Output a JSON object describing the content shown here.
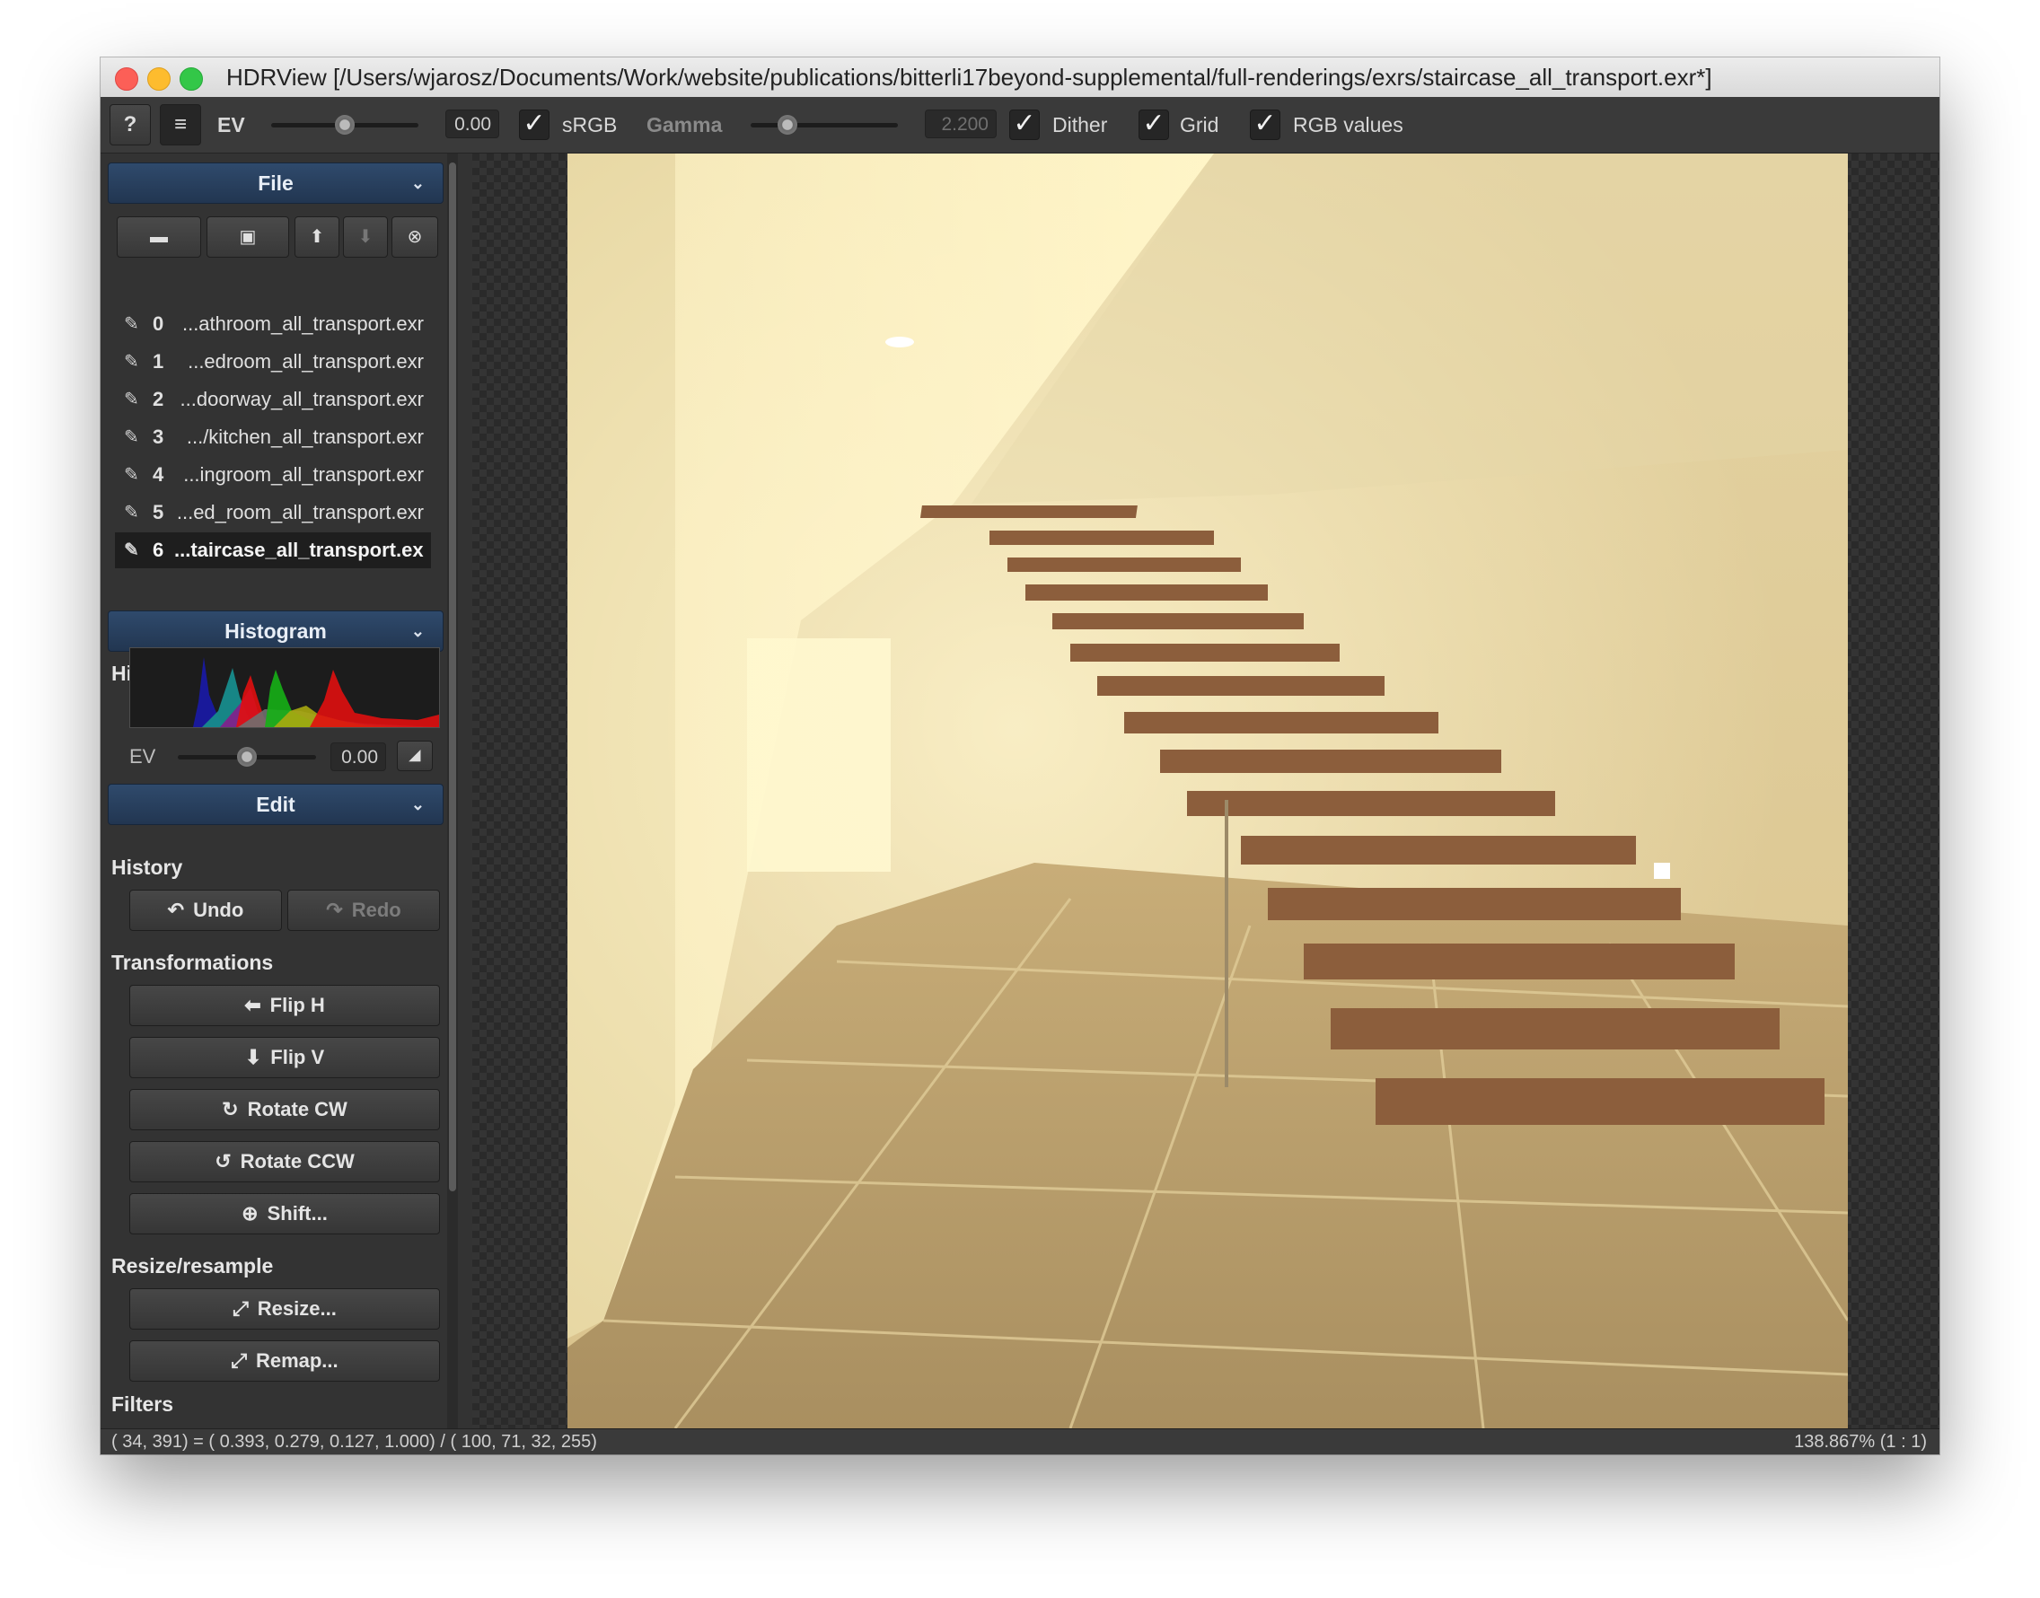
{
  "window": {
    "title": "HDRView [/Users/wjarosz/Documents/Work/website/publications/bitterli17beyond-supplemental/full-renderings/exrs/staircase_all_transport.exr*]"
  },
  "toolbar": {
    "help_label": "?",
    "menu_label": "≡",
    "ev_label": "EV",
    "ev_value": "0.00",
    "ev_slider_fraction": 0.5,
    "srgb_label": "sRGB",
    "srgb_checked": true,
    "gamma_label": "Gamma",
    "gamma_value": "2.200",
    "gamma_slider_fraction": 0.25,
    "dither_label": "Dither",
    "dither_checked": true,
    "grid_label": "Grid",
    "grid_checked": true,
    "rgb_values_label": "RGB values",
    "rgb_values_checked": true,
    "check_glyph": "✓"
  },
  "sidebar": {
    "file_section": {
      "title": "File",
      "chevron": "⌄"
    },
    "file_buttons": [
      {
        "icon": "folder-open-icon",
        "glyph": "▬",
        "enabled": true
      },
      {
        "icon": "save-icon",
        "glyph": "▣",
        "enabled": true
      },
      {
        "icon": "arrow-up-icon",
        "glyph": "⬆",
        "enabled": true
      },
      {
        "icon": "arrow-down-icon",
        "glyph": "⬇",
        "enabled": false
      },
      {
        "icon": "close-circle-icon",
        "glyph": "⊗",
        "enabled": true
      }
    ],
    "files": [
      {
        "index": "0",
        "name": "...athroom_all_transport.exr",
        "selected": false
      },
      {
        "index": "1",
        "name": "...edroom_all_transport.exr",
        "selected": false
      },
      {
        "index": "2",
        "name": "...doorway_all_transport.exr",
        "selected": false
      },
      {
        "index": "3",
        "name": ".../kitchen_all_transport.exr",
        "selected": false
      },
      {
        "index": "4",
        "name": "...ingroom_all_transport.exr",
        "selected": false
      },
      {
        "index": "5",
        "name": "...ed_room_all_transport.exr",
        "selected": false
      },
      {
        "index": "6",
        "name": "...taircase_all_transport.exr",
        "selected": true
      }
    ],
    "file_pencil_glyph": "✎",
    "histogram_section": {
      "title": "Histogram",
      "chevron": "⌄"
    },
    "histogram_label": "Histogram",
    "histogram_colors": {
      "red": "#e01010",
      "green": "#16b016",
      "blue": "#1a1aa8",
      "cyan": "#178c8c",
      "yellow": "#a8a810",
      "magenta": "#8c178c",
      "gray": "#707070"
    },
    "hist_ev_label": "EV",
    "hist_ev_value": "0.00",
    "hist_ev_slider_fraction": 0.5,
    "hist_mode_glyph": "◢",
    "edit_section": {
      "title": "Edit",
      "chevron": "⌄"
    },
    "history_label": "History",
    "undo": {
      "icon": "undo-icon",
      "glyph": "↶",
      "label": "Undo",
      "enabled": true
    },
    "redo": {
      "icon": "redo-icon",
      "glyph": "↷",
      "label": "Redo",
      "enabled": false
    },
    "transformations_label": "Transformations",
    "flip_h": {
      "glyph": "⬅",
      "label": "Flip H"
    },
    "flip_v": {
      "glyph": "⬇",
      "label": "Flip V"
    },
    "rotate_cw": {
      "glyph": "↻",
      "label": "Rotate CW"
    },
    "rotate_ccw": {
      "glyph": "↺",
      "label": "Rotate CCW"
    },
    "shift": {
      "glyph": "⊕",
      "label": "Shift..."
    },
    "resize_label": "Resize/resample",
    "resize": {
      "glyph": "⤢",
      "label": "Resize..."
    },
    "remap": {
      "glyph": "⤢",
      "label": "Remap..."
    },
    "filters_label": "Filters"
  },
  "canvas": {
    "image_description_colors": {
      "wall": "#e6d6a4",
      "floor": "#b99d6c",
      "step": "#8c5e3c",
      "window": "#fffbd0"
    }
  },
  "status": {
    "pixel_info": "( 34, 391) = ( 0.393,  0.279,  0.127,  1.000) / ( 100,  71,  32,  255)",
    "zoom": "138.867% (1 : 1)"
  }
}
